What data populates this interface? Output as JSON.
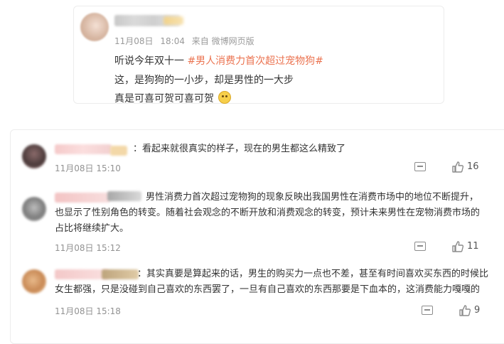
{
  "post": {
    "date": "11月08日",
    "time": "18:04",
    "source": "来自 微博网页版",
    "line1_prefix": "听说今年双十一 ",
    "hashtag": "#男人消费力首次超过宠物狗#",
    "line2": "这，是狗狗的一小步，却是男性的一大步",
    "line3": "真是可喜可贺可喜可贺",
    "emoji_icon": "doge-emoji-icon"
  },
  "comments": [
    {
      "lines": [
        "：看起来就很真实的样子，现在的男生都这么精致了"
      ],
      "time": "11月08日 15:10",
      "likes": "16"
    },
    {
      "lines": [
        "男性消费力首次超过宠物狗的现象反映出我国男性在消费市场中的地位不断提升，",
        "也显示了性别角色的转变。随着社会观念的不断开放和消费观念的转变，预计未来男性在宠物消费市场的",
        "占比将继续扩大。"
      ],
      "time": "11月08日 15:12",
      "likes": "11"
    },
    {
      "lines": [
        "：其实真要是算起来的话，男生的购买力一点也不差，甚至有时间喜欢买东西的时候比",
        "女生都强，只是没碰到自己喜欢的东西罢了，一旦有自己喜欢的东西那要是下血本的，这消费能力嘎嘎的"
      ],
      "time": "11月08日 15:18",
      "likes": "9"
    }
  ],
  "colors": {
    "hashtag": "#eb7350",
    "text": "#333333",
    "meta": "#939393"
  }
}
